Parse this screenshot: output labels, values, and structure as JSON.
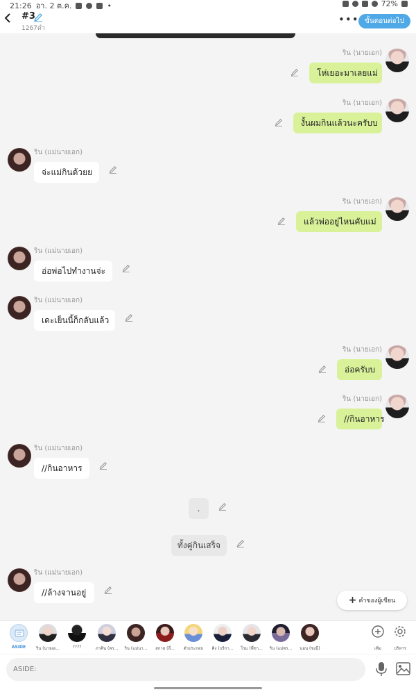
{
  "status": {
    "time": "21:26",
    "date": "อา. 2 ต.ค.",
    "dot": "•",
    "battery": "72%"
  },
  "header": {
    "title": "#3",
    "subtitle": "1267คำ",
    "more": "•••",
    "next_label": "ขั้นตอนต่อไป"
  },
  "messages": [
    {
      "side": "right",
      "name": "ริน (นายเอก)",
      "text": "โห่เยอะมาเลยแม่"
    },
    {
      "side": "right",
      "name": "ริน (นายเอก)",
      "text": "งั้นผมกินแล้วนะครับบ"
    },
    {
      "side": "left",
      "name": "ริน (แม่นายเอก)",
      "text": "จ่ะแม่กินด้วยย"
    },
    {
      "side": "right",
      "name": "ริน (นายเอก)",
      "text": "แล้วพ่ออยู่ไหนคับแม่"
    },
    {
      "side": "left",
      "name": "ริน (แม่นายเอก)",
      "text": "อ่อพ่อไปทำงานจ่ะ"
    },
    {
      "side": "left",
      "name": "ริน (แม่นายเอก)",
      "text": "เดะเย็นนี้ก็กลับแล้ว"
    },
    {
      "side": "right",
      "name": "ริน (นายเอก)",
      "text": "อ่อครับบ"
    },
    {
      "side": "right",
      "name": "ริน (นายเอก)",
      "text": "//กินอาหาร"
    },
    {
      "side": "left",
      "name": "ริน (แม่นายเอก)",
      "text": "//กินอาหาร"
    },
    {
      "side": "center",
      "name": "",
      "text": "."
    },
    {
      "side": "center",
      "name": "",
      "text": "ทั้งคู่กินเสร็จ"
    },
    {
      "side": "left",
      "name": "ริน (แม่นายเอก)",
      "text": "//ล้างจานอยู่"
    }
  ],
  "add_button": {
    "plus": "+",
    "label": "คำของผู้เขียน"
  },
  "characters": [
    {
      "label": "ASIDE"
    },
    {
      "label": "ริน (นายเอ..."
    },
    {
      "label": "????"
    },
    {
      "label": "ภาคิน (พร..."
    },
    {
      "label": "ริน (แม่นา..."
    },
    {
      "label": "สกาย (ลี่..."
    },
    {
      "label": "ตัวประกอบ"
    },
    {
      "label": "คิง (บริกา..."
    },
    {
      "label": "โรม (พี่ชา..."
    },
    {
      "label": "ริน (แม่พร..."
    },
    {
      "label": "นอน (ชงนี)"
    }
  ],
  "tools": {
    "add_label": "เพิ่ม",
    "service_label": "บริหาร"
  },
  "input": {
    "placeholder": "ASIDE:"
  },
  "icons": {
    "back": "chevron-left-icon",
    "edit": "pencil-icon",
    "mic": "mic-icon",
    "image": "image-icon",
    "gear": "gear-icon",
    "plus": "plus-circle-icon"
  },
  "colors": {
    "accent": "#4fa9e6",
    "bubble_right": "#d9f29a",
    "bubble_left": "#ffffff",
    "bubble_center": "#e8e8e8"
  }
}
